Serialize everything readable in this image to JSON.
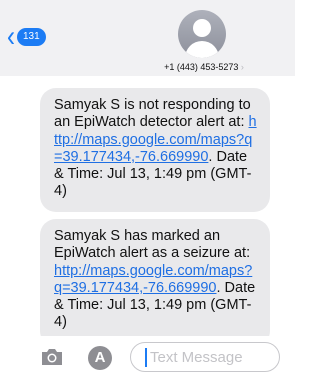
{
  "header": {
    "back_count": "131",
    "back_chevron": "‹",
    "phone_number": "+1 (443) 453-5273",
    "phone_chevron": "›"
  },
  "messages": [
    {
      "text_before": "Samyak S is not responding to an EpiWatch detector alert at: ",
      "link": "http://maps.google.com/maps?q=39.177434,-76.669990",
      "text_after": ". Date & Time: Jul 13, 1:49 pm (GMT-4)"
    },
    {
      "text_before": "Samyak S has marked an EpiWatch alert as a seizure at: ",
      "link": "http://maps.google.com/maps?q=39.177434,-76.669990",
      "text_after": ". Date & Time: Jul 13, 1:49 pm (GMT-4)"
    }
  ],
  "input_bar": {
    "placeholder": "Text Message",
    "camera_icon": "camera-icon",
    "apps_icon": "app-store-icon",
    "apps_glyph": "A"
  },
  "colors": {
    "accent": "#1c7cf4",
    "bubble": "#e9e9eb",
    "link": "#1f6fe3"
  }
}
